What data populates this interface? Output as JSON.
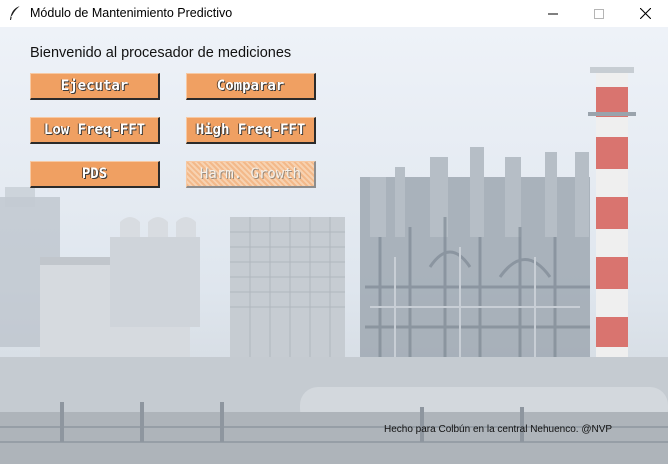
{
  "window": {
    "title": "Módulo de Mantenimiento Predictivo",
    "icon": "feather-icon",
    "controls": [
      "minimize-icon",
      "maximize-icon",
      "close-icon"
    ]
  },
  "main": {
    "welcome": "Bienvenido al procesador de mediciones",
    "buttons": {
      "ejecutar": "Ejecutar",
      "comparar": "Comparar",
      "low_fft": "Low Freq-FFT",
      "high_fft": "High Freq-FFT",
      "pds": "PDS",
      "harm": "Harm. Growth"
    },
    "harm_enabled": false,
    "button_color": "#f0a062",
    "background": "power-plant-photo"
  },
  "footer": {
    "credit": "Hecho para Colbún en la central Nehuenco. @NVP"
  }
}
